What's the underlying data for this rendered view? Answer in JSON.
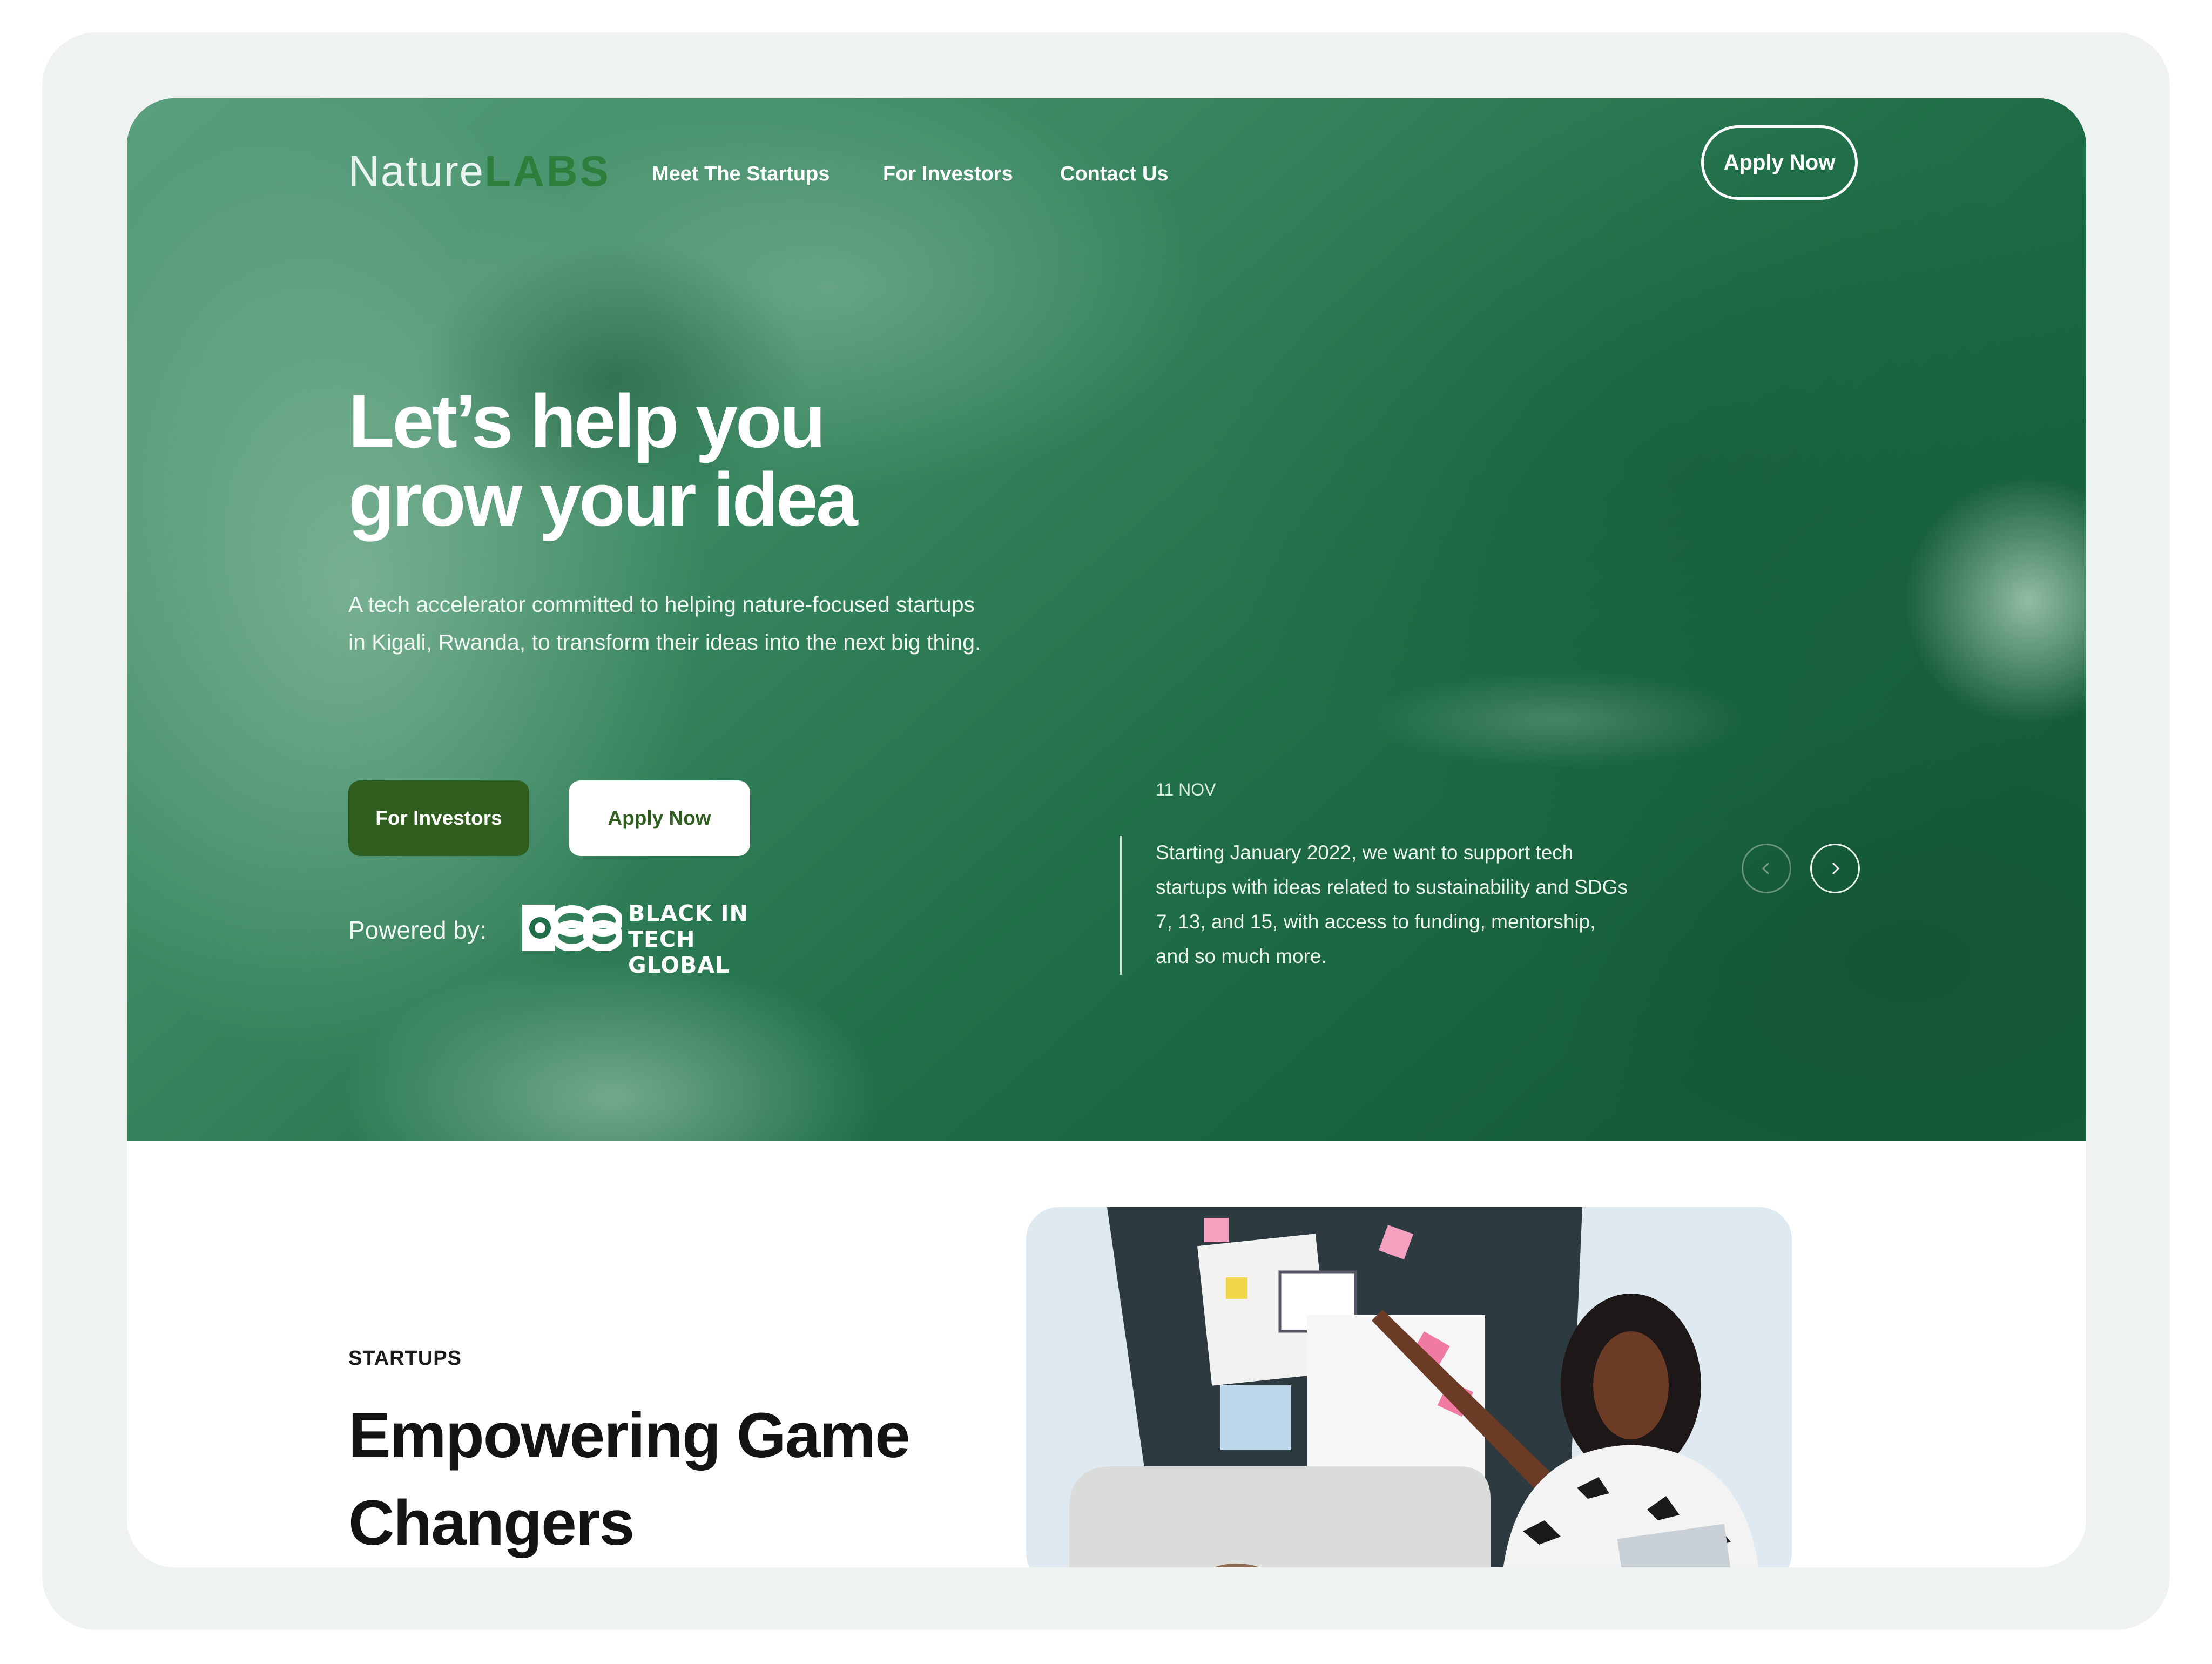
{
  "brand": {
    "logo_nature": "Nature",
    "logo_labs": "LABS"
  },
  "nav": {
    "items": [
      "Meet The Startups",
      "For Investors",
      "Contact Us"
    ],
    "apply_label": "Apply Now"
  },
  "hero": {
    "headline_line1": "Let’s help you",
    "headline_line2": "grow your idea",
    "lead": "A tech accelerator committed to helping nature-focused startups in Kigali, Rwanda, to transform their ideas into the next big thing.",
    "primary_button": "For Investors",
    "secondary_button": "Apply Now",
    "powered_by": "Powered by:",
    "partner_line1": "BLACK IN",
    "partner_line2": "TECH GLOBAL"
  },
  "news": {
    "date": "11 NOV",
    "text": "Starting January 2022, we want to support tech startups with ideas related to sustainability and SDGs 7, 13, and 15, with access to funding, mentorship, and so much more.",
    "prev_icon": "chevron-left-icon",
    "next_icon": "chevron-right-icon"
  },
  "startups": {
    "label": "STARTUPS",
    "title": "Empowering Game Changers"
  },
  "colors": {
    "hero_green": "#1e6b45",
    "button_dark": "#2f5e1f",
    "frame": "#eef3f1"
  }
}
